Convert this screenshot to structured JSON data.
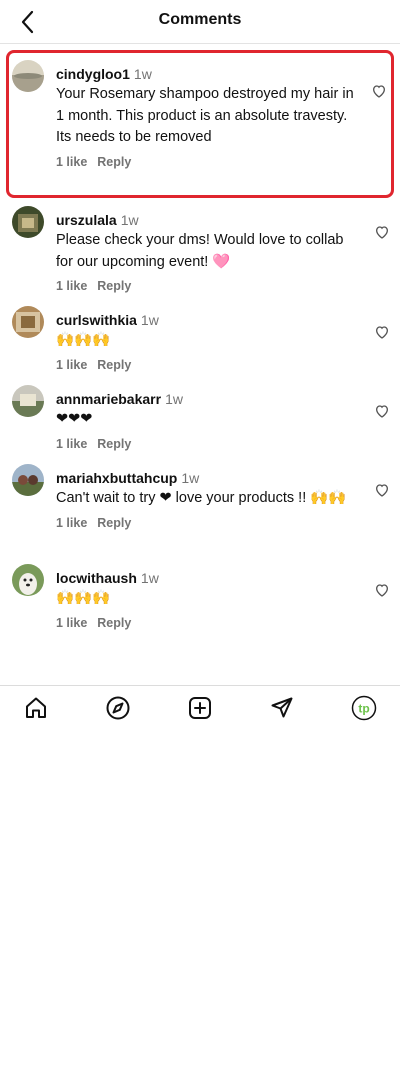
{
  "header": {
    "title": "Comments"
  },
  "comments": [
    {
      "username": "cindygloo1",
      "time": "1w",
      "text": "Your Rosemary shampoo destroyed my hair in 1 month. This product is an absolute travesty. Its needs to be removed",
      "likes": "1 like",
      "reply": "Reply"
    },
    {
      "username": "urszulala",
      "time": "1w",
      "text": "Please check your dms! Would love to collab for our upcoming event! 🩷",
      "likes": "1 like",
      "reply": "Reply"
    },
    {
      "username": "curlswithkia",
      "time": "1w",
      "text": "🙌🙌🙌",
      "likes": "1 like",
      "reply": "Reply"
    },
    {
      "username": "annmariebakarr",
      "time": "1w",
      "text": "❤❤❤",
      "likes": "1 like",
      "reply": "Reply"
    },
    {
      "username": "mariahxbuttahcup",
      "time": "1w",
      "text": "Can't wait to try ❤ love your products !! 🙌🙌",
      "likes": "1 like",
      "reply": "Reply"
    },
    {
      "username": "locwithaush",
      "time": "1w",
      "text": "🙌🙌🙌",
      "likes": "1 like",
      "reply": "Reply"
    }
  ],
  "colors": {
    "highlight": "#e0262f",
    "profile_accent": "#6cc24a"
  },
  "profile_initials": "tp",
  "icons": [
    "back-arrow-icon",
    "heart-outline-icon",
    "home-icon",
    "compass-icon",
    "add-square-icon",
    "send-icon",
    "profile-icon"
  ]
}
